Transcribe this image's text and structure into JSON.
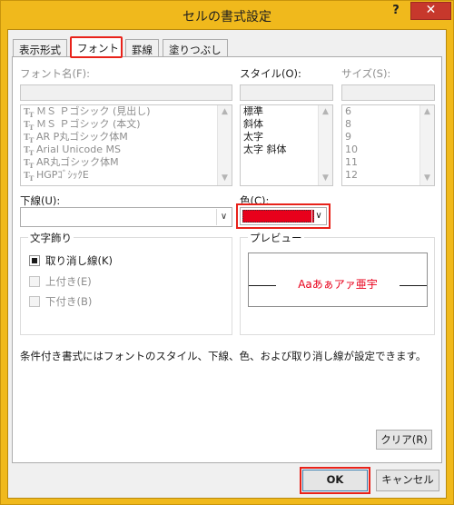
{
  "window": {
    "title": "セルの書式設定",
    "help_glyph": "?",
    "close_glyph": "✕"
  },
  "tabs": [
    {
      "label": "表示形式"
    },
    {
      "label": "フォント"
    },
    {
      "label": "罫線"
    },
    {
      "label": "塗りつぶし"
    }
  ],
  "font_name": {
    "label": "フォント名(F):",
    "value": "",
    "items": [
      "ＭＳ Ｐゴシック (見出し)",
      "ＭＳ Ｐゴシック (本文)",
      "AR P丸ゴシック体M",
      "Arial Unicode MS",
      "AR丸ゴシック体M",
      "HGPｺﾞｼｯｸE"
    ],
    "item_icon": "truetype-font-icon"
  },
  "style": {
    "label": "スタイル(O):",
    "value": "",
    "items": [
      "標準",
      "斜体",
      "太字",
      "太字 斜体"
    ]
  },
  "size": {
    "label": "サイズ(S):",
    "value": "",
    "items": [
      "6",
      "8",
      "9",
      "10",
      "11",
      "12"
    ]
  },
  "underline": {
    "label": "下線(U):",
    "value": ""
  },
  "color": {
    "label": "色(C):",
    "swatch": "#e8001b"
  },
  "effects": {
    "title": "文字飾り",
    "strike_label": "取り消し線(K)",
    "strike_checked": true,
    "superscript_label": "上付き(E)",
    "subscript_label": "下付き(B)"
  },
  "preview": {
    "title": "プレビュー",
    "sample": "Aaあぁアァ亜宇"
  },
  "info_text": "条件付き書式にはフォントのスタイル、下線、色、および取り消し線が設定できます。",
  "buttons": {
    "clear": "クリア(R)",
    "ok": "OK",
    "cancel": "キャンセル"
  },
  "colors": {
    "accent_frame": "#f0b91c",
    "highlight_red": "#e8221a",
    "close_red": "#c7382c"
  }
}
